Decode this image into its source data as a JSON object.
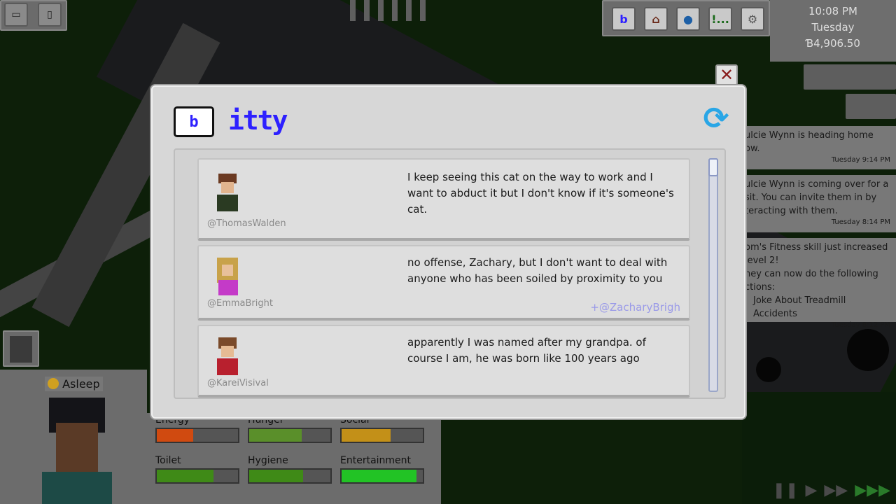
{
  "clock": {
    "time": "10:08 PM",
    "day": "Tuesday",
    "money": "Ɓ4,906.50"
  },
  "toolbar": {
    "icons": [
      "phone-app-icon",
      "build-icon",
      "world-icon",
      "objectives-icon",
      "settings-icon"
    ],
    "objectives_label": "!..."
  },
  "notifications": [
    {
      "lines": [
        "ulcie Wynn is heading home",
        "ow."
      ],
      "time": "Tuesday 9:14 PM"
    },
    {
      "lines": [
        "ulcie Wynn is coming over for a",
        "sit. You can invite them in by",
        "teracting with them."
      ],
      "time": "Tuesday 8:14 PM"
    },
    {
      "lines": [
        "om's Fitness skill just increased",
        "level 2!",
        "ney can now do the following",
        "ctions:",
        "Joke About Treadmill Accidents"
      ],
      "time": "Tuesday 8:12 PM"
    }
  ],
  "status": {
    "label": "Asleep"
  },
  "needs": [
    {
      "label": "Energy",
      "level": 0.45,
      "color": "#d04a10"
    },
    {
      "label": "Hunger",
      "level": 0.65,
      "color": "#5a8f2a"
    },
    {
      "label": "Social",
      "level": 0.6,
      "color": "#c39018"
    },
    {
      "label": "Toilet",
      "level": 0.7,
      "color": "#3f8a17"
    },
    {
      "label": "Hygiene",
      "level": 0.66,
      "color": "#3f8a17"
    },
    {
      "label": "Entertainment",
      "level": 0.92,
      "color": "#22c325"
    }
  ],
  "app": {
    "logo_glyph": "b",
    "title": "itty",
    "close": "✕"
  },
  "posts": [
    {
      "handle": "@ThomasWalden",
      "text": "I keep seeing this cat on the way to work and I want to abduct it but I don't know if it's someone's cat.",
      "mention": ""
    },
    {
      "handle": "@EmmaBright",
      "text": "no offense, Zachary, but I don't want to deal with anyone who has been soiled by proximity to you",
      "mention": "+@ZacharyBrigh"
    },
    {
      "handle": "@KareiVisival",
      "text": "apparently I was named after my grandpa. of course I am, he was born like 100 years ago",
      "mention": ""
    }
  ],
  "speed_controls": [
    "pause",
    "play",
    "fast",
    "fastest"
  ]
}
